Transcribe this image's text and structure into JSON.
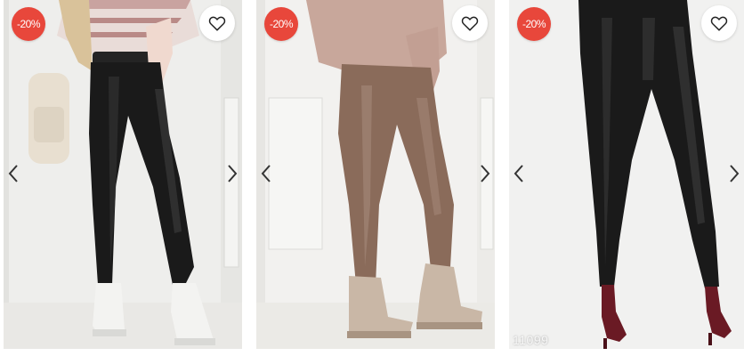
{
  "products": [
    {
      "discount_badge": "-20%",
      "image_alt": "black-leather-leggings-white-boots",
      "sku_overlay": ""
    },
    {
      "discount_badge": "-20%",
      "image_alt": "mocha-leather-leggings-beige-boots",
      "sku_overlay": ""
    },
    {
      "discount_badge": "-20%",
      "image_alt": "black-leather-leggings-burgundy-heels",
      "sku_overlay": "11099"
    }
  ],
  "colors": {
    "badge": "#e8473b",
    "black_leather": "#1a1a1a",
    "mocha_leather": "#8a6b5a",
    "sweater_pink": "#c8a79b",
    "white_boot": "#f3f3f1",
    "beige_boot": "#c9b7a6",
    "heel_burgundy": "#6a1a24"
  },
  "icons": {
    "favorite": "heart-outline-icon",
    "prev": "chevron-left-icon",
    "next": "chevron-right-icon"
  }
}
